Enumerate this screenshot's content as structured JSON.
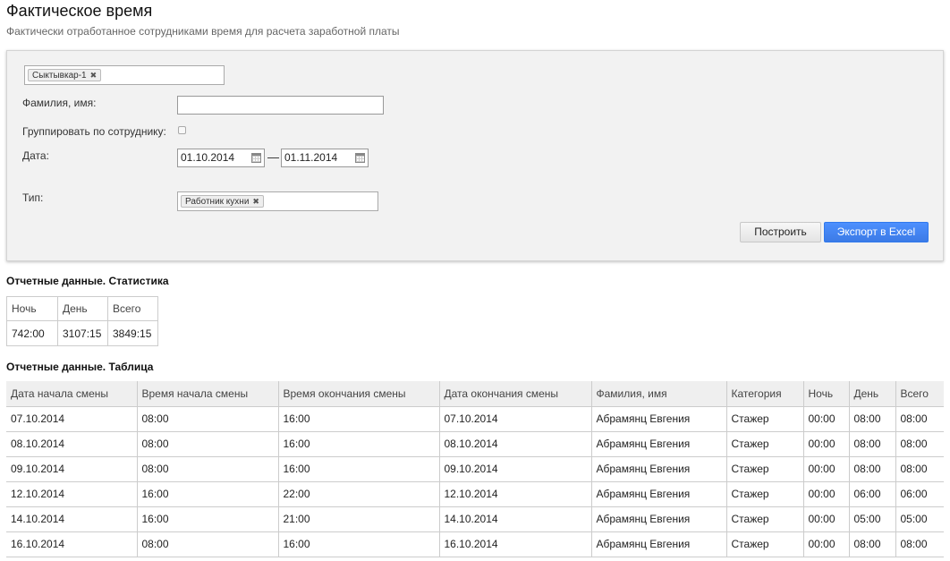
{
  "page": {
    "title": "Фактическое время",
    "subtitle": "Фактически отработанное сотрудниками время для расчета заработной платы"
  },
  "filters": {
    "location_tag": "Сыктывкар-1",
    "name_label": "Фамилия, имя:",
    "name_value": "",
    "group_label": "Группировать по сотруднику:",
    "group_checked": false,
    "date_label": "Дата:",
    "date_from": "01.10.2014",
    "date_separator": "—",
    "date_to": "01.11.2014",
    "type_label": "Тип:",
    "type_tag": "Работник кухни",
    "build_button": "Построить",
    "export_button": "Экспорт в Excel",
    "tag_remove_glyph": "✖"
  },
  "stats": {
    "title": "Отчетные данные. Статистика",
    "headers": [
      "Ночь",
      "День",
      "Всего"
    ],
    "values": [
      "742:00",
      "3107:15",
      "3849:15"
    ]
  },
  "report": {
    "title": "Отчетные данные. Таблица",
    "headers": [
      "Дата начала смены",
      "Время начала смены",
      "Время окончания смены",
      "Дата окончания смены",
      "Фамилия, имя",
      "Категория",
      "Ночь",
      "День",
      "Всего"
    ],
    "rows": [
      [
        "07.10.2014",
        "08:00",
        "16:00",
        "07.10.2014",
        "Абрамянц Евгения",
        "Стажер",
        "00:00",
        "08:00",
        "08:00"
      ],
      [
        "08.10.2014",
        "08:00",
        "16:00",
        "08.10.2014",
        "Абрамянц Евгения",
        "Стажер",
        "00:00",
        "08:00",
        "08:00"
      ],
      [
        "09.10.2014",
        "08:00",
        "16:00",
        "09.10.2014",
        "Абрамянц Евгения",
        "Стажер",
        "00:00",
        "08:00",
        "08:00"
      ],
      [
        "12.10.2014",
        "16:00",
        "22:00",
        "12.10.2014",
        "Абрамянц Евгения",
        "Стажер",
        "00:00",
        "06:00",
        "06:00"
      ],
      [
        "14.10.2014",
        "16:00",
        "21:00",
        "14.10.2014",
        "Абрамянц Евгения",
        "Стажер",
        "00:00",
        "05:00",
        "05:00"
      ],
      [
        "16.10.2014",
        "08:00",
        "16:00",
        "16.10.2014",
        "Абрамянц Евгения",
        "Стажер",
        "00:00",
        "08:00",
        "08:00"
      ]
    ]
  }
}
